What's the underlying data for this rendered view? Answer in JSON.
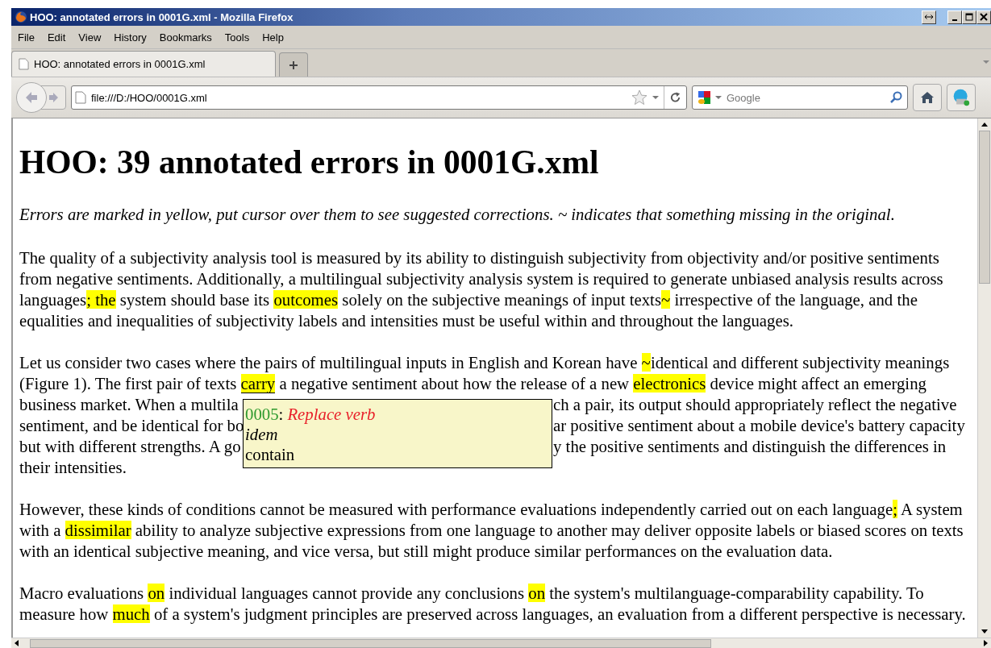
{
  "window": {
    "title": "HOO: annotated errors in 0001G.xml - Mozilla Firefox"
  },
  "menu": [
    "File",
    "Edit",
    "View",
    "History",
    "Bookmarks",
    "Tools",
    "Help"
  ],
  "tabs": [
    {
      "label": "HOO: annotated errors in 0001G.xml",
      "selected": true
    }
  ],
  "address_bar": {
    "value": "file:///D:/HOO/0001G.xml"
  },
  "search": {
    "placeholder": "Google"
  },
  "page": {
    "heading": "HOO: 39 annotated errors in 0001G.xml",
    "intro": "Errors are marked in yellow, put cursor over them to see suggested corrections. ~ indicates that something missing in the original.",
    "paragraphs": [
      {
        "kind": "flow",
        "segments": [
          {
            "text": "The quality of a subjectivity analysis tool is measured by its ability to distinguish subjectivity from objectivity and/or positive sentiments from negative sentiments. Additionally, a multilingual subjectivity analysis system is required to generate unbiased analysis results across languages",
            "marked": false
          },
          {
            "text": "; the",
            "marked": true
          },
          {
            "text": " system should base its ",
            "marked": false
          },
          {
            "text": "outcomes",
            "marked": true
          },
          {
            "text": " solely on the subjective meanings of input texts",
            "marked": false
          },
          {
            "text": "~",
            "marked": true
          },
          {
            "text": " irrespective of the language, and the equalities and inequalities of subjectivity labels and intensities must be useful within and throughout the languages.",
            "marked": false
          }
        ]
      },
      {
        "kind": "lines",
        "lines": [
          {
            "left": [
              {
                "text": "Let us consider two cases where the pairs of multilingual inputs in English and Korean have ",
                "marked": false
              },
              {
                "text": "~",
                "marked": true
              },
              {
                "text": "identical and different subjectivity meanings",
                "marked": false
              }
            ]
          },
          {
            "left": [
              {
                "text": "(Figure 1). The first pair of texts ",
                "marked": false
              },
              {
                "text": "carry",
                "marked": true,
                "hovered": true
              },
              {
                "text": " a negative sentiment about how the release of a new ",
                "marked": false
              },
              {
                "text": "electronics",
                "marked": true
              },
              {
                "text": " device might affect an emerging",
                "marked": false
              }
            ]
          },
          {
            "left": [
              {
                "text": "business market. When a multila",
                "marked": false
              }
            ],
            "right": [
              {
                "text": "ch a pair, its output should appropriately reflect the negative",
                "marked": false
              }
            ]
          },
          {
            "left": [
              {
                "text": "sentiment, and be identical for bo",
                "marked": false
              }
            ],
            "right": [
              {
                "text": "ar positive sentiment about a mobile device's battery capacity",
                "marked": false
              }
            ]
          },
          {
            "left": [
              {
                "text": "but with different strengths. A go",
                "marked": false
              }
            ],
            "right": [
              {
                "text": "y the positive sentiments and distinguish the differences in",
                "marked": false
              }
            ]
          },
          {
            "left": [
              {
                "text": "their intensities.",
                "marked": false
              }
            ]
          }
        ],
        "tooltip": {
          "id": "0005",
          "separator": ":",
          "type": "Replace verb",
          "original": "idem",
          "correction": "contain"
        }
      },
      {
        "kind": "flow",
        "segments": [
          {
            "text": "However, these kinds of conditions cannot be measured with performance evaluations independently carried out on each language",
            "marked": false
          },
          {
            "text": ";",
            "marked": true
          },
          {
            "text": " A system with a ",
            "marked": false
          },
          {
            "text": "dissimilar",
            "marked": true
          },
          {
            "text": " ability to analyze subjective expressions from one language to another may deliver opposite labels or biased scores on texts with an identical subjective meaning, and vice versa, but still might produce similar performances on the evaluation data.",
            "marked": false
          }
        ]
      },
      {
        "kind": "flow",
        "segments": [
          {
            "text": "Macro evaluations ",
            "marked": false
          },
          {
            "text": "on",
            "marked": true
          },
          {
            "text": " individual languages cannot provide any conclusions ",
            "marked": false
          },
          {
            "text": "on",
            "marked": true
          },
          {
            "text": " the system's multilanguage-comparability capability. To measure how ",
            "marked": false
          },
          {
            "text": "much",
            "marked": true
          },
          {
            "text": " of a system's judgment principles are preserved across languages, an evaluation from a different perspective is necessary.",
            "marked": false
          }
        ]
      }
    ]
  }
}
